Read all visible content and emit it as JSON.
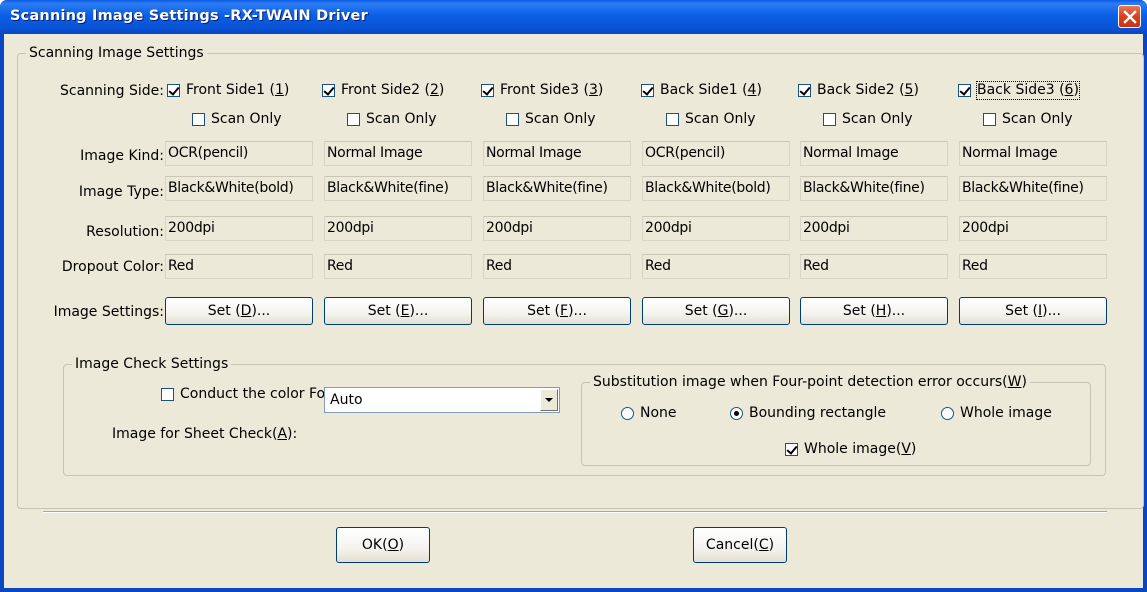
{
  "window": {
    "title": "Scanning Image Settings -RX-TWAIN Driver"
  },
  "scanning_group": {
    "label": "Scanning Image Settings",
    "row_labels": {
      "scanning_side": "Scanning Side:",
      "image_kind": "Image Kind:",
      "image_type": "Image Type:",
      "resolution": "Resolution:",
      "dropout_color": "Dropout Color:",
      "image_settings": "Image Settings:"
    },
    "scan_only_label": "Scan Only",
    "sides": [
      {
        "side_pre": "Front Side1 (",
        "side_key": "1",
        "side_post": ")",
        "checked": true,
        "scan_only": false,
        "image_kind": "OCR(pencil)",
        "image_type": "Black&White(bold)",
        "resolution": "200dpi",
        "dropout": "Red",
        "set_pre": "Set (",
        "set_key": "D",
        "set_post": ")..."
      },
      {
        "side_pre": "Front Side2 (",
        "side_key": "2",
        "side_post": ")",
        "checked": true,
        "scan_only": false,
        "image_kind": "Normal Image",
        "image_type": "Black&White(fine)",
        "resolution": "200dpi",
        "dropout": "Red",
        "set_pre": "Set (",
        "set_key": "E",
        "set_post": ")..."
      },
      {
        "side_pre": "Front Side3 (",
        "side_key": "3",
        "side_post": ")",
        "checked": true,
        "scan_only": false,
        "image_kind": "Normal Image",
        "image_type": "Black&White(fine)",
        "resolution": "200dpi",
        "dropout": "Red",
        "set_pre": "Set (",
        "set_key": "F",
        "set_post": ")..."
      },
      {
        "side_pre": "Back Side1 (",
        "side_key": "4",
        "side_post": ")",
        "checked": true,
        "scan_only": false,
        "image_kind": "OCR(pencil)",
        "image_type": "Black&White(bold)",
        "resolution": "200dpi",
        "dropout": "Red",
        "set_pre": "Set (",
        "set_key": "G",
        "set_post": ")..."
      },
      {
        "side_pre": "Back Side2 (",
        "side_key": "5",
        "side_post": ")",
        "checked": true,
        "scan_only": false,
        "image_kind": "Normal Image",
        "image_type": "Black&White(fine)",
        "resolution": "200dpi",
        "dropout": "Red",
        "set_pre": "Set (",
        "set_key": "H",
        "set_post": ")..."
      },
      {
        "side_pre": "Back Side3 (",
        "side_key": "6",
        "side_post": ")",
        "checked": true,
        "scan_only": false,
        "image_kind": "Normal Image",
        "image_type": "Black&White(fine)",
        "resolution": "200dpi",
        "dropout": "Red",
        "set_pre": "Set (",
        "set_key": "I",
        "set_post": ")..."
      }
    ]
  },
  "check_group": {
    "label": "Image Check Settings",
    "color_detect_pre": "Conduct the color Four-point detection(",
    "color_detect_key": "Z",
    "color_detect_post": ")",
    "color_detect_checked": false,
    "sheet_check_pre": "Image for Sheet Check(",
    "sheet_check_key": "A",
    "sheet_check_post": "):",
    "sheet_check_value": "Auto"
  },
  "substitution_group": {
    "label_pre": "Substitution image when Four-point detection error occurs(",
    "label_key": "W",
    "label_post": ")",
    "options": [
      "None",
      "Bounding rectangle",
      "Whole image"
    ],
    "selected": "Bounding rectangle",
    "whole_pre": "Whole image(",
    "whole_key": "V",
    "whole_post": ")",
    "whole_checked": true
  },
  "buttons": {
    "ok_pre": "OK(",
    "ok_key": "O",
    "ok_post": ")",
    "cancel_pre": "Cancel(",
    "cancel_key": "C",
    "cancel_post": ")"
  }
}
